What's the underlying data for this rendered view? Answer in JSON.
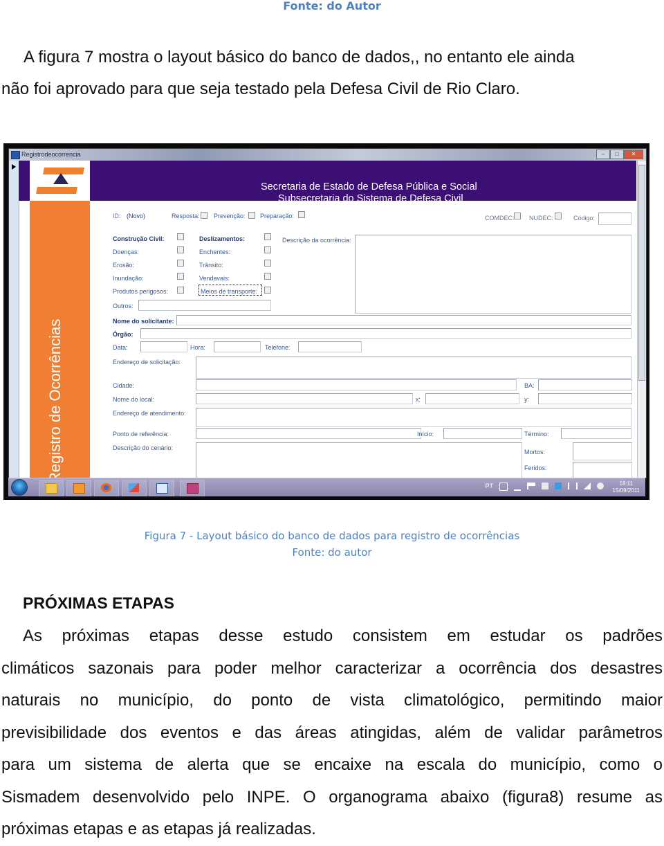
{
  "top_caption": "Fonte:  do Autor",
  "intro_paragraph": {
    "lines": [
      "A figura 7 mostra o layout básico do banco de dados,, no entanto ele ainda",
      "não foi aprovado para que seja testado pela Defesa Civil de Rio Claro."
    ]
  },
  "screenshot": {
    "window_title": "Registrodeocorrencia",
    "window_buttons": [
      "minimize",
      "maximize",
      "close"
    ],
    "header": {
      "line1": "Secretaria de Estado de Defesa Pública e Social",
      "line2": "Subsecretaria do Sistema de Defesa Civil"
    },
    "side_title": "Registro de Ocorrências",
    "form": {
      "id_label": "ID:",
      "id_value": "(Novo)",
      "top_checks": [
        "Resposta:",
        "Prevenção:",
        "Preparação:"
      ],
      "org_checks": [
        "COMDEC:",
        "NUDEC:"
      ],
      "codigo_label": "Código:",
      "category_checks_left": [
        "Construção Civil:",
        "Doenças:",
        "Erosão:",
        "Inundação:",
        "Produtos perigosos:"
      ],
      "category_checks_right": [
        "Deslizamentos:",
        "Enchentes:",
        "Trânsito:",
        "Vendavais:",
        "Meios de transporte:"
      ],
      "descricao_ocorrencia_label": "Descrição da ocorrência:",
      "outros_label": "Outros:",
      "nome_solicitante_label": "Nome do solicitante:",
      "orgao_label": "Órgão:",
      "data_label": "Data:",
      "hora_label": "Hora:",
      "telefone_label": "Telefone:",
      "endereco_solicitacao_label": "Endereço de solicitação:",
      "cidade_label": "Cidade:",
      "ba_label": "BA:",
      "nome_local_label": "Nome do local:",
      "x_label": "x:",
      "y_label": "y:",
      "endereco_atendimento_label": "Endereço de atendimento:",
      "ponto_referencia_label": "Ponto de referência:",
      "inicio_label": "Início:",
      "termino_label": "Término:",
      "descricao_cenario_label": "Descrição do cenário:",
      "mortos_label": "Mortos:",
      "feridos_label": "Feridos:"
    },
    "taskbar": {
      "apps": [
        "start-orb",
        "windows-explorer",
        "media-player",
        "firefox",
        "network-app",
        "word-document",
        "access-database"
      ],
      "tray_lang": "PT",
      "clock_time": "18:11",
      "clock_date": "15/09/2011"
    }
  },
  "figure_caption": "Figura 7 - Layout básico do banco de dados para registro de ocorrências",
  "figure_source": "Fonte: do autor",
  "section_title": "PRÓXIMAS ETAPAS",
  "section_paragraph": {
    "lines": [
      "As próximas etapas desse estudo consistem em estudar os padrões",
      "climáticos sazonais para poder melhor caracterizar a ocorrência dos desastres",
      "naturais no município, do ponto de vista climatológico, permitindo maior",
      "previsibilidade dos eventos e das áreas atingidas, além de validar parâmetros",
      "para um sistema de alerta que se encaixe na escala do município, como o",
      "Sismadem desenvolvido pelo INPE. O organograma abaixo (figura8) resume as",
      "próximas etapas e as etapas já realizadas."
    ]
  },
  "colors": {
    "caption_blue": "#4f81bd",
    "header_purple": "#3b0f73",
    "side_orange": "#f07f34"
  }
}
